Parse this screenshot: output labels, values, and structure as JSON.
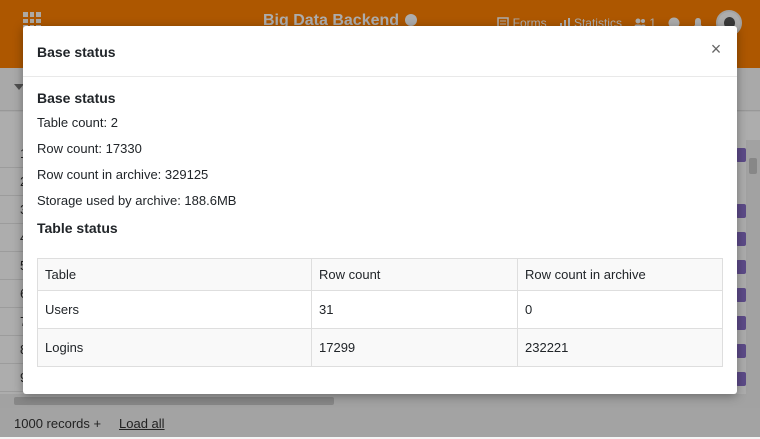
{
  "app": {
    "title": "Big Data Backend",
    "top_actions": {
      "forms_label": "Forms",
      "statistics_label": "Statistics",
      "collaborators_count": "1"
    },
    "accent_color": "#ff8000"
  },
  "grid": {
    "row_numbers": [
      "1",
      "2",
      "3",
      "4",
      "5",
      "6",
      "7",
      "8",
      "9"
    ]
  },
  "footer": {
    "records_label": "1000 records +",
    "load_all_label": "Load all"
  },
  "modal": {
    "title": "Base status",
    "close_label": "×",
    "base_section_title": "Base status",
    "stats": {
      "table_count": "Table count: 2",
      "row_count": "Row count: 17330",
      "row_count_archive": "Row count in archive: 329125",
      "storage_archive": "Storage used by archive: 188.6MB"
    },
    "table_section_title": "Table status",
    "table": {
      "headers": [
        "Table",
        "Row count",
        "Row count in archive"
      ],
      "rows": [
        [
          "Users",
          "31",
          "0"
        ],
        [
          "Logins",
          "17299",
          "232221"
        ]
      ]
    }
  }
}
